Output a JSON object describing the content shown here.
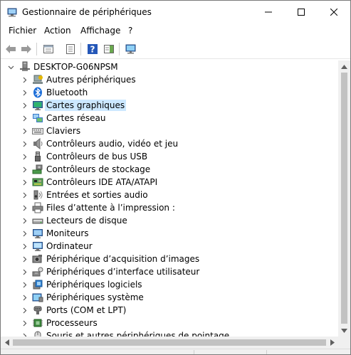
{
  "window": {
    "title": "Gestionnaire de périphériques",
    "controls": [
      "minimize-icon",
      "maximize-icon",
      "close-icon"
    ]
  },
  "menu": [
    "Fichier",
    "Action",
    "Affichage",
    "?"
  ],
  "toolbar": {
    "buttons": [
      "back-icon",
      "forward-icon",
      "properties-view-icon",
      "device-list-icon",
      "help-icon",
      "action-pane-icon",
      "monitor-scan-icon"
    ]
  },
  "tree": {
    "root": "DESKTOP-G06NPSM",
    "items": [
      {
        "label": "Autres périphériques",
        "icon": "unknown-device-icon"
      },
      {
        "label": "Bluetooth",
        "icon": "bluetooth-icon"
      },
      {
        "label": "Cartes graphiques",
        "icon": "display-adapter-icon"
      },
      {
        "label": "Cartes réseau",
        "icon": "network-adapter-icon"
      },
      {
        "label": "Claviers",
        "icon": "keyboard-icon"
      },
      {
        "label": "Contrôleurs audio, vidéo et jeu",
        "icon": "speaker-icon"
      },
      {
        "label": "Contrôleurs de bus USB",
        "icon": "usb-icon"
      },
      {
        "label": "Contrôleurs de stockage",
        "icon": "storage-controller-icon"
      },
      {
        "label": "Contrôleurs IDE ATA/ATAPI",
        "icon": "ide-controller-icon"
      },
      {
        "label": "Entrées et sorties audio",
        "icon": "audio-io-icon"
      },
      {
        "label": "Files d’attente à l’impression :",
        "icon": "printer-icon"
      },
      {
        "label": "Lecteurs de disque",
        "icon": "disk-drive-icon"
      },
      {
        "label": "Moniteurs",
        "icon": "monitor-icon"
      },
      {
        "label": "Ordinateur",
        "icon": "computer-icon"
      },
      {
        "label": "Périphérique d’acquisition d’images",
        "icon": "camera-icon"
      },
      {
        "label": "Périphériques d’interface utilisateur",
        "icon": "hid-icon"
      },
      {
        "label": "Périphériques logiciels",
        "icon": "software-device-icon"
      },
      {
        "label": "Périphériques système",
        "icon": "system-device-icon"
      },
      {
        "label": "Ports (COM et LPT)",
        "icon": "port-icon"
      },
      {
        "label": "Processeurs",
        "icon": "processor-icon"
      },
      {
        "label": "Souris et autres périphériques de pointage",
        "icon": "mouse-icon"
      }
    ],
    "selected": "Cartes graphiques"
  },
  "colors": {
    "selection": "#cce8ff",
    "scrollbar": "#f0f0f0",
    "thumb": "#c2c2c2"
  }
}
